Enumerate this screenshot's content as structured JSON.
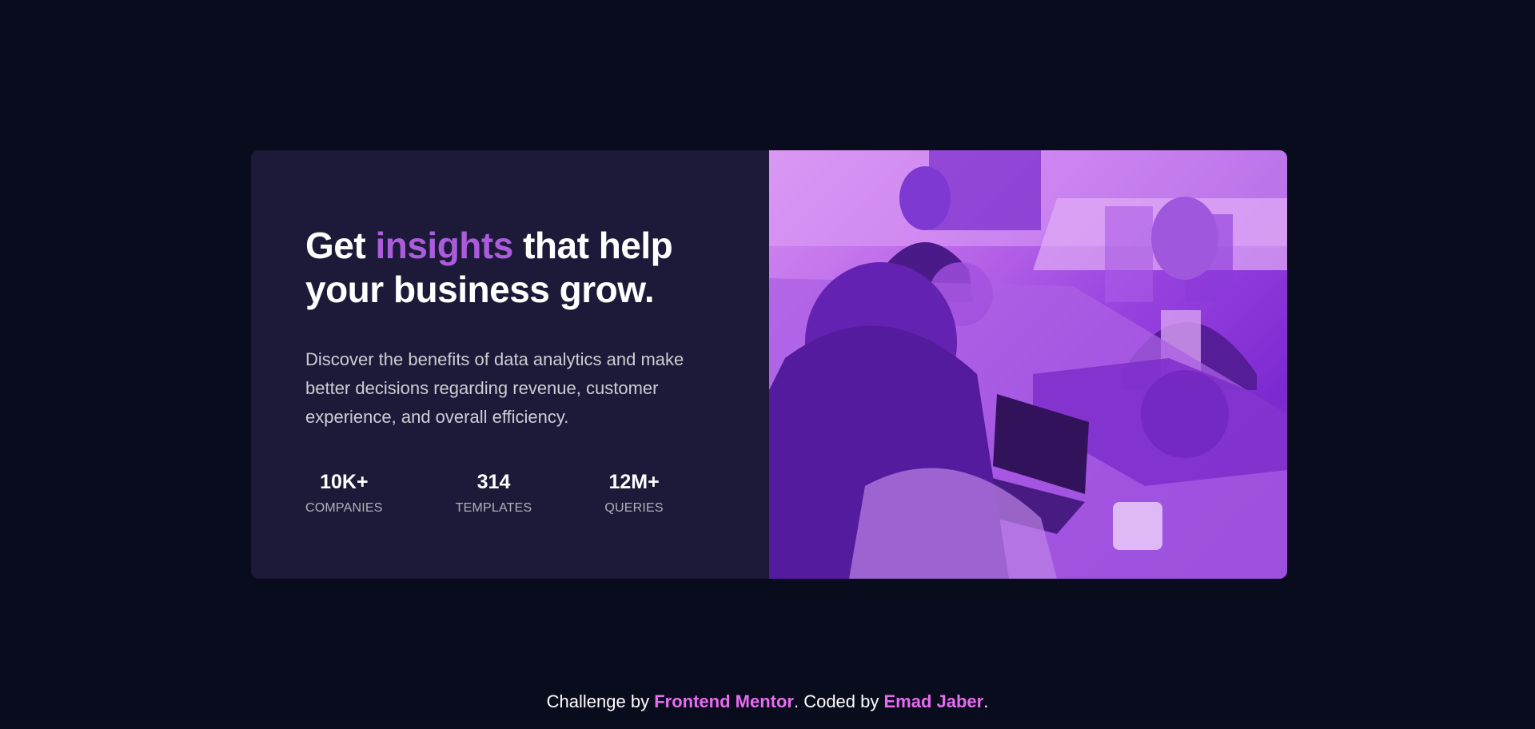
{
  "card": {
    "headline": {
      "part1": "Get ",
      "accent": "insights",
      "part2": " that help your business grow."
    },
    "description": "Discover the benefits of data analytics and make better decisions regarding revenue, customer experience, and overall efficiency.",
    "stats": [
      {
        "value": "10K+",
        "label": "COMPANIES"
      },
      {
        "value": "314",
        "label": "TEMPLATES"
      },
      {
        "value": "12M+",
        "label": "QUERIES"
      }
    ],
    "image_description": "office-photo"
  },
  "footer": {
    "prefix": "Challenge by ",
    "link1": "Frontend Mentor",
    "middle": ". Coded by ",
    "link2": "Emad Jaber",
    "suffix": "."
  },
  "colors": {
    "background": "#090c1d",
    "card": "#1c1a38",
    "accent": "#aa5cdb",
    "image_tint": "#9a44df",
    "footer_link": "#e86cf0"
  }
}
